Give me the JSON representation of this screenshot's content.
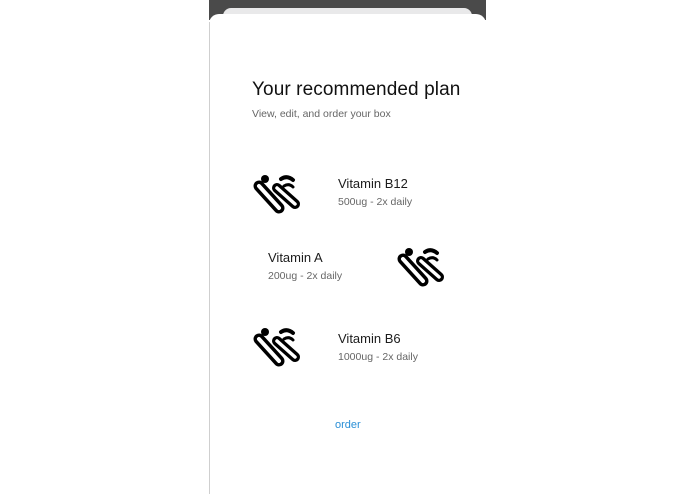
{
  "header": {
    "title": "Your recommended plan",
    "subtitle": "View, edit, and order your box"
  },
  "plan": {
    "items": [
      {
        "name": "Vitamin B12",
        "dose": "500ug - 2x daily",
        "icon": "pill-capsules-icon"
      },
      {
        "name": "Vitamin A",
        "dose": "200ug - 2x daily",
        "icon": "pill-capsules-icon"
      },
      {
        "name": "Vitamin B6",
        "dose": "1000ug - 2x daily",
        "icon": "pill-capsules-icon"
      }
    ]
  },
  "actions": {
    "order_label": "order"
  },
  "colors": {
    "link": "#2a8fd6",
    "text": "#111111",
    "muted": "#666666"
  }
}
